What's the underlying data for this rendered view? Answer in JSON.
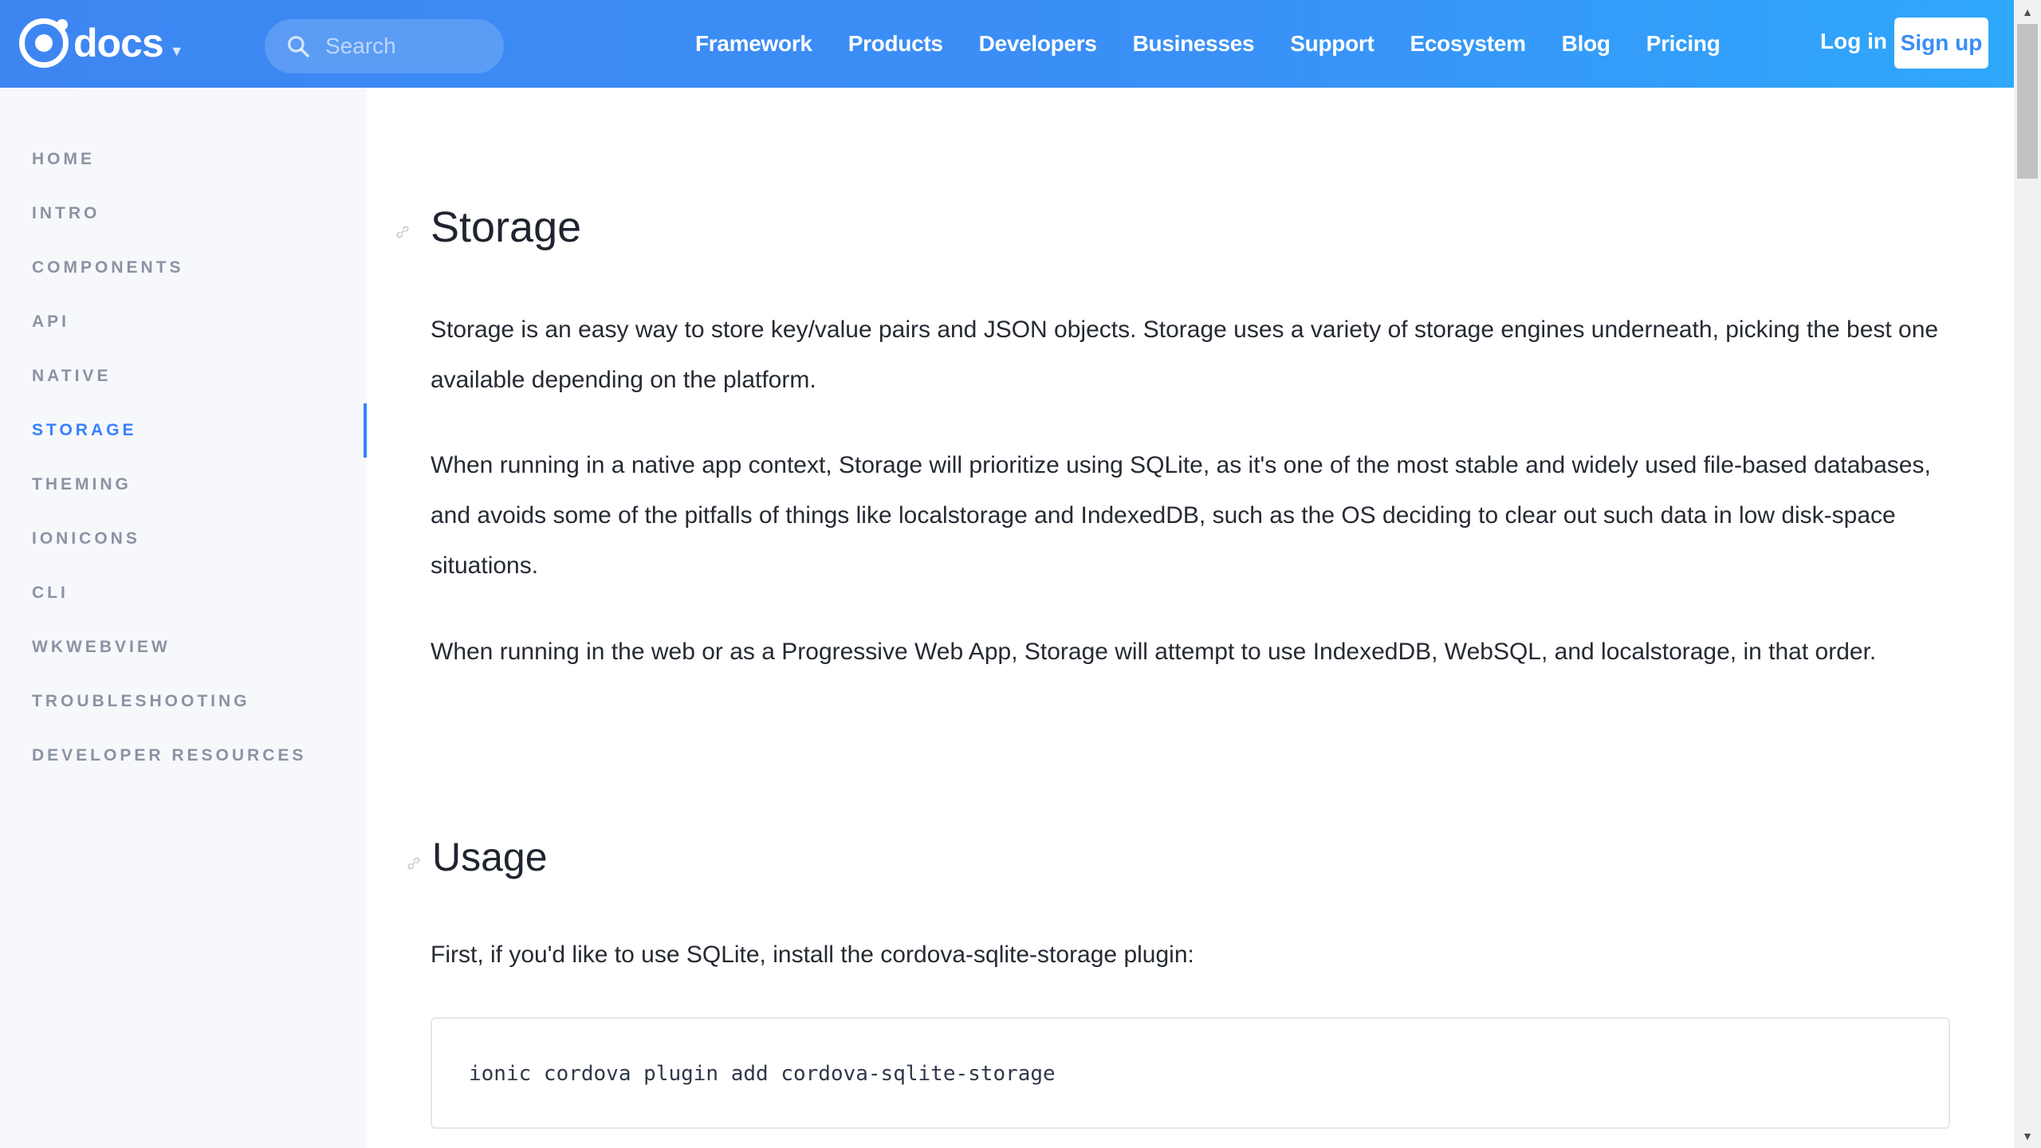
{
  "header": {
    "logo_text": "docs",
    "search_placeholder": "Search",
    "nav": [
      "Framework",
      "Products",
      "Developers",
      "Businesses",
      "Support",
      "Ecosystem",
      "Blog",
      "Pricing"
    ],
    "login_label": "Log in",
    "signup_label": "Sign up"
  },
  "sidebar": {
    "items": [
      {
        "label": "HOME",
        "active": false
      },
      {
        "label": "INTRO",
        "active": false
      },
      {
        "label": "COMPONENTS",
        "active": false
      },
      {
        "label": "API",
        "active": false
      },
      {
        "label": "NATIVE",
        "active": false
      },
      {
        "label": "STORAGE",
        "active": true
      },
      {
        "label": "THEMING",
        "active": false
      },
      {
        "label": "IONICONS",
        "active": false
      },
      {
        "label": "CLI",
        "active": false
      },
      {
        "label": "WKWEBVIEW",
        "active": false
      },
      {
        "label": "TROUBLESHOOTING",
        "active": false
      },
      {
        "label": "DEVELOPER RESOURCES",
        "active": false
      }
    ]
  },
  "content": {
    "title": "Storage",
    "paragraphs": [
      "Storage is an easy way to store key/value pairs and JSON objects. Storage uses a variety of storage engines underneath, picking the best one available depending on the platform.",
      "When running in a native app context, Storage will prioritize using SQLite, as it's one of the most stable and widely used file-based databases, and avoids some of the pitfalls of things like localstorage and IndexedDB, such as the OS deciding to clear out such data in low disk-space situations.",
      "When running in the web or as a Progressive Web App, Storage will attempt to use IndexedDB, WebSQL, and localstorage, in that order."
    ],
    "usage_heading": "Usage",
    "usage_intro": "First, if you'd like to use SQLite, install the cordova-sqlite-storage plugin:",
    "code": "ionic cordova plugin add cordova-sqlite-storage"
  },
  "colors": {
    "header_gradient_start": "#3d86f2",
    "header_gradient_end": "#2ea8fb",
    "accent": "#3880ff",
    "sidebar_bg": "#f7f8fb",
    "sidebar_text": "#8a93a3"
  },
  "icons": {
    "search": "search-icon",
    "anchor": "link-icon",
    "logo": "ionic-logo-icon"
  }
}
